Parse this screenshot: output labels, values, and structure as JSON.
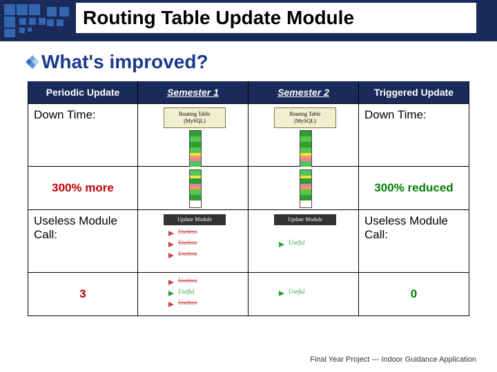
{
  "title": "Routing Table Update Module",
  "subtitle": "What's improved?",
  "headers": {
    "col1": "Periodic  Update",
    "col2": "Semester 1",
    "col3": "Semester 2",
    "col4": "Triggered Update"
  },
  "rows": {
    "downtime_left": "Down Time:",
    "downtime_right": "Down Time:",
    "pct_left": "300% more",
    "pct_right": "300% reduced",
    "useless_left": "Useless Module Call:",
    "useless_right": "Useless Module Call:",
    "count_left": "3",
    "count_right": "0"
  },
  "diagram": {
    "db_label_1": "Routing Table",
    "db_label_2": "(MySQL)",
    "mod_label": "Update Module",
    "useless_tag": "Useless",
    "useful_tag": "Useful"
  },
  "footer": "Final Year Project --- Indoor Guidance Application"
}
